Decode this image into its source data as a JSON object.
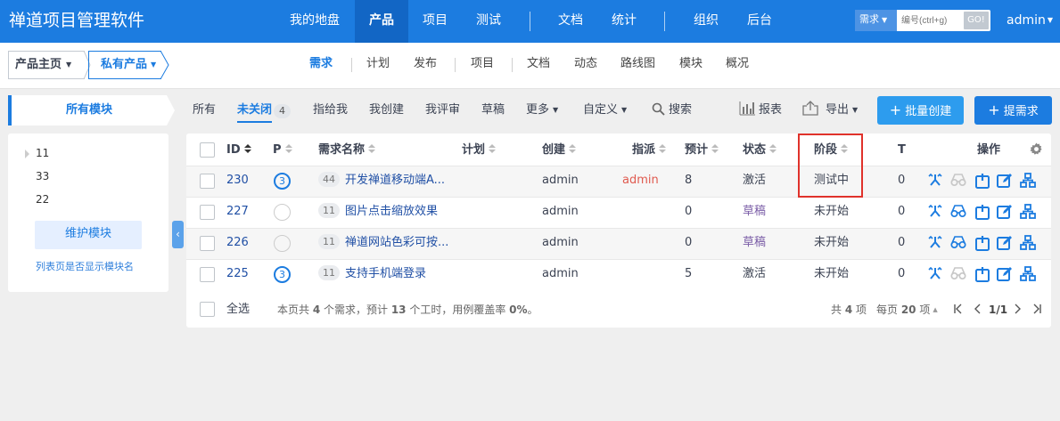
{
  "topbar": {
    "brand": "禅道项目管理软件",
    "nav": [
      {
        "label": "我的地盘",
        "active": false
      },
      {
        "label": "产品",
        "active": true
      },
      {
        "label": "项目",
        "active": false
      },
      {
        "label": "测试",
        "active": false
      },
      {
        "label": "文档",
        "active": false
      },
      {
        "label": "统计",
        "active": false
      },
      {
        "label": "组织",
        "active": false
      },
      {
        "label": "后台",
        "active": false
      }
    ],
    "search": {
      "type_label": "需求",
      "placeholder": "编号(ctrl+g)",
      "go_label": "GO!"
    },
    "user": "admin"
  },
  "subbar": {
    "breadcrumb": {
      "home": "产品主页",
      "product": "私有产品"
    },
    "tabs": [
      "需求",
      "计划",
      "发布",
      "项目",
      "文档",
      "动态",
      "路线图",
      "模块",
      "概况"
    ],
    "active_tab": "需求"
  },
  "sidebar": {
    "title": "所有模块",
    "modules": [
      "11",
      "33",
      "22"
    ],
    "manage_button": "维护模块",
    "toggle_link": "列表页是否显示模块名"
  },
  "filters": {
    "tabs": [
      "所有",
      "未关闭",
      "指给我",
      "我创建",
      "我评审",
      "草稿",
      "更多",
      "自定义"
    ],
    "active": "未关闭",
    "active_count": "4",
    "search": "搜索",
    "report": "报表",
    "export": "导出",
    "batch_create": "批量创建",
    "create": "提需求"
  },
  "table": {
    "columns": {
      "id": "ID",
      "pri": "P",
      "title": "需求名称",
      "plan": "计划",
      "openedBy": "创建",
      "assignedTo": "指派",
      "estimate": "预计",
      "status": "状态",
      "stage": "阶段",
      "t": "T",
      "actions": "操作"
    },
    "rows": [
      {
        "id": "230",
        "pri": "3",
        "module_tag": "44",
        "title": "开发禅道移动端A...",
        "plan": "",
        "openedBy": "admin",
        "assignedTo": "admin",
        "estimate": "8",
        "status": "激活",
        "stage": "测试中",
        "t": "0"
      },
      {
        "id": "227",
        "pri": "",
        "module_tag": "11",
        "title": "图片点击缩放效果",
        "plan": "",
        "openedBy": "admin",
        "assignedTo": "",
        "estimate": "0",
        "status": "草稿",
        "stage": "未开始",
        "t": "0"
      },
      {
        "id": "226",
        "pri": "",
        "module_tag": "11",
        "title": "禅道网站色彩可按...",
        "plan": "",
        "openedBy": "admin",
        "assignedTo": "",
        "estimate": "0",
        "status": "草稿",
        "stage": "未开始",
        "t": "0"
      },
      {
        "id": "225",
        "pri": "3",
        "module_tag": "11",
        "title": "支持手机端登录",
        "plan": "",
        "openedBy": "admin",
        "assignedTo": "",
        "estimate": "5",
        "status": "激活",
        "stage": "未开始",
        "t": "0"
      }
    ],
    "footer": {
      "select_all": "全选",
      "summary_prefix": "本页共 ",
      "summary_count": "4",
      "summary_mid": " 个需求，预计 ",
      "summary_hours": "13",
      "summary_suffix": " 个工时，用例覆盖率 ",
      "summary_coverage": "0%",
      "summary_end": "。",
      "total_prefix": "共 ",
      "total_count": "4",
      "total_suffix": " 项",
      "per_page_prefix": "每页 ",
      "per_page": "20",
      "per_page_suffix": " 项",
      "page": "1/1"
    }
  },
  "colors": {
    "primary": "#1c7ce0",
    "danger": "#e0322b",
    "draft": "#7b5ea7",
    "assigned": "#e05a4f"
  }
}
